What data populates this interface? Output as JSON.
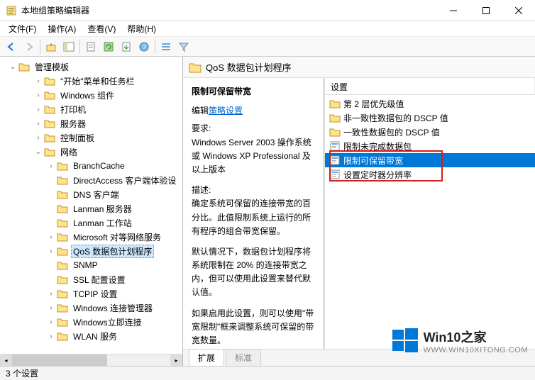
{
  "window": {
    "title": "本地组策略编辑器",
    "controls": {
      "min": "–",
      "max": "☐",
      "close": "✕"
    }
  },
  "menu": {
    "items": [
      "文件(F)",
      "操作(A)",
      "查看(V)",
      "帮助(H)"
    ]
  },
  "toolbar": {
    "buttons": [
      "back",
      "forward",
      "up",
      "folder-tree",
      "props",
      "refresh",
      "export",
      "help",
      "details",
      "filter"
    ]
  },
  "tree": {
    "root": "管理模板",
    "children": [
      {
        "label": "\"开始\"菜单和任务栏",
        "depth": 2
      },
      {
        "label": "Windows 组件",
        "depth": 2
      },
      {
        "label": "打印机",
        "depth": 2
      },
      {
        "label": "服务器",
        "depth": 2
      },
      {
        "label": "控制面板",
        "depth": 2
      },
      {
        "label": "网络",
        "depth": 2,
        "expanded": true
      },
      {
        "label": "BranchCache",
        "depth": 3
      },
      {
        "label": "DirectAccess 客户端体验设",
        "depth": 3
      },
      {
        "label": "DNS 客户端",
        "depth": 3
      },
      {
        "label": "Lanman 服务器",
        "depth": 3
      },
      {
        "label": "Lanman 工作站",
        "depth": 3
      },
      {
        "label": "Microsoft 对等网络服务",
        "depth": 3
      },
      {
        "label": "QoS 数据包计划程序",
        "depth": 3,
        "selected": true
      },
      {
        "label": "SNMP",
        "depth": 3
      },
      {
        "label": "SSL 配置设置",
        "depth": 3
      },
      {
        "label": "TCPIP 设置",
        "depth": 3
      },
      {
        "label": "Windows 连接管理器",
        "depth": 3
      },
      {
        "label": "Windows立即连接",
        "depth": 3
      },
      {
        "label": "WLAN 服务",
        "depth": 3
      }
    ]
  },
  "content": {
    "title": "QoS 数据包计划程序",
    "desc": {
      "heading": "限制可保留带宽",
      "edit_prefix": "编辑",
      "edit_link": "策略设置",
      "req_label": "要求:",
      "req_text": "Windows Server 2003 操作系统或 Windows XP Professional 及以上版本",
      "desc_label": "描述:",
      "desc_text": "确定系统可保留的连接带宽的百分比。此值限制系统上运行的所有程序的组合带宽保留。",
      "para2": "默认情况下，数据包计划程序将系统限制在 20% 的连接带宽之内，但可以使用此设置来替代默认值。",
      "para3": "如果启用此设置，则可以使用\"带宽限制\"框来调整系统可保留的带宽数量。"
    },
    "list": {
      "column": "设置",
      "items": [
        {
          "label": "第 2 层优先级值",
          "icon": "folder"
        },
        {
          "label": "非一致性数据包的 DSCP 值",
          "icon": "folder"
        },
        {
          "label": "一致性数据包的 DSCP 值",
          "icon": "folder"
        },
        {
          "label": "限制未完成数据包",
          "icon": "setting"
        },
        {
          "label": "限制可保留带宽",
          "icon": "setting",
          "selected": true
        },
        {
          "label": "设置定时器分辨率",
          "icon": "setting"
        }
      ]
    },
    "tabs": {
      "extended": "扩展",
      "standard": "标准"
    }
  },
  "statusbar": {
    "text": "3 个设置"
  },
  "watermark": {
    "brand": "Win10之家",
    "url": "WWW.WIN10XITONG.COM"
  }
}
